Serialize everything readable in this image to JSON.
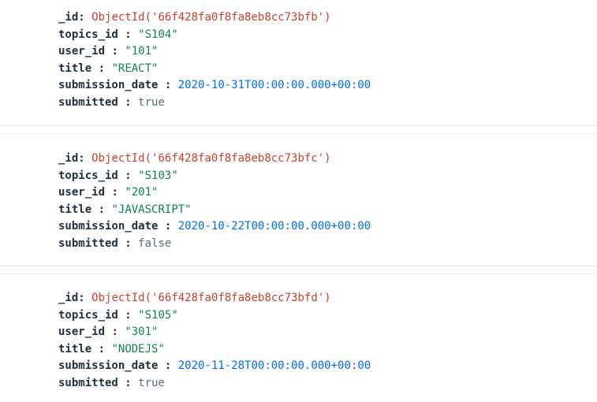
{
  "documents": [
    {
      "id": {
        "key": "_id",
        "sep": ":",
        "value": "ObjectId('66f428fa0f8fa8eb8cc73bfb')"
      },
      "topics_id": {
        "key": "topics_id",
        "sep": ":",
        "value": "\"S104\""
      },
      "user_id": {
        "key": "user_id",
        "sep": ":",
        "value": "\"101\""
      },
      "title": {
        "key": "title",
        "sep": ":",
        "value": "\"REACT\""
      },
      "submission_date": {
        "key": "submission_date",
        "sep": ":",
        "value": "2020-10-31T00:00:00.000+00:00"
      },
      "submitted": {
        "key": "submitted",
        "sep": ":",
        "value": "true"
      }
    },
    {
      "id": {
        "key": "_id",
        "sep": ":",
        "value": "ObjectId('66f428fa0f8fa8eb8cc73bfc')"
      },
      "topics_id": {
        "key": "topics_id",
        "sep": ":",
        "value": "\"S103\""
      },
      "user_id": {
        "key": "user_id",
        "sep": ":",
        "value": "\"201\""
      },
      "title": {
        "key": "title",
        "sep": ":",
        "value": "\"JAVASCRIPT\""
      },
      "submission_date": {
        "key": "submission_date",
        "sep": ":",
        "value": "2020-10-22T00:00:00.000+00:00"
      },
      "submitted": {
        "key": "submitted",
        "sep": ":",
        "value": "false"
      }
    },
    {
      "id": {
        "key": "_id",
        "sep": ":",
        "value": "ObjectId('66f428fa0f8fa8eb8cc73bfd')"
      },
      "topics_id": {
        "key": "topics_id",
        "sep": ":",
        "value": "\"S105\""
      },
      "user_id": {
        "key": "user_id",
        "sep": ":",
        "value": "\"301\""
      },
      "title": {
        "key": "title",
        "sep": ":",
        "value": "\"NODEJS\""
      },
      "submission_date": {
        "key": "submission_date",
        "sep": ":",
        "value": "2020-11-28T00:00:00.000+00:00"
      },
      "submitted": {
        "key": "submitted",
        "sep": ":",
        "value": "true"
      }
    }
  ],
  "colors": {
    "key": "#21313c",
    "object_id": "#c7422e",
    "string": "#12824d",
    "date": "#016bf8",
    "boolean": "#5c6c75",
    "divider": "#e6e9eb"
  }
}
